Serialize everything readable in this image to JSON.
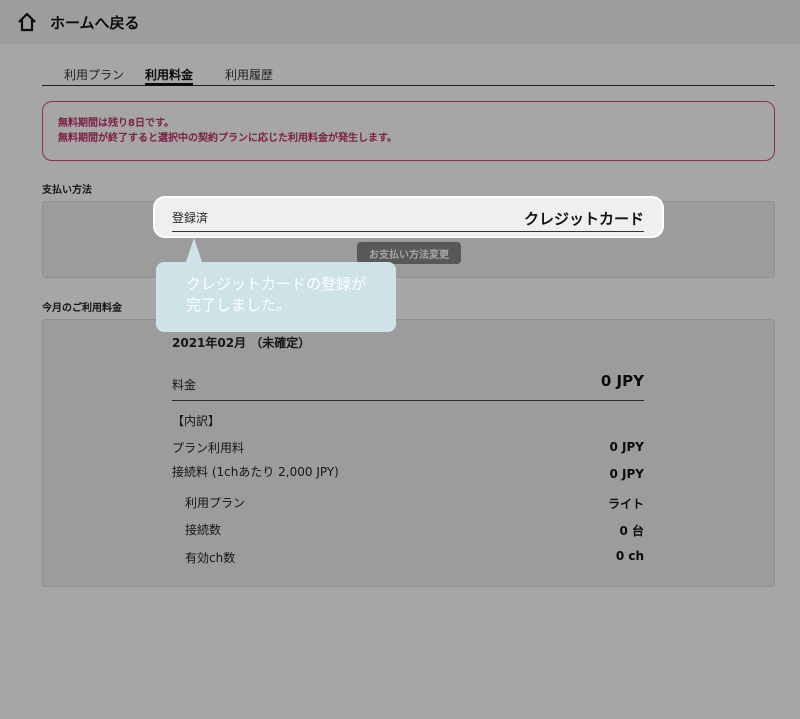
{
  "header": {
    "title": "ホームへ戻る"
  },
  "tabs": [
    {
      "label": "利用プラン",
      "active": false
    },
    {
      "label": "利用料金",
      "active": true
    },
    {
      "label": "利用履歴",
      "active": false
    }
  ],
  "notice": {
    "line1": "無料期間は残り8日です。",
    "line2": "無料期間が終了すると選択中の契約プランに応じた利用料金が発生します。"
  },
  "payment": {
    "section_label": "支払い方法",
    "status_label": "登録済",
    "method": "クレジットカード",
    "change_button": "お支払い方法変更"
  },
  "callout": {
    "text_line1": "クレジットカードの登録が",
    "text_line2": "完了しました。"
  },
  "billing": {
    "section_label": "今月のご利用料金",
    "period": "2021年02月 （未確定）",
    "fee_label": "料金",
    "fee_value": "0 JPY",
    "breakdown_label": "【内訳】",
    "plan_fee_label": "プラン利用料",
    "plan_fee_value": "0 JPY",
    "connection_fee_label": "接続料 (1chあたり 2,000 JPY)",
    "connection_fee_value": "0 JPY",
    "plan_label": "利用プラン",
    "plan_value": "ライト",
    "connections_label": "接続数",
    "connections_value": "0 台",
    "channels_label": "有効ch数",
    "channels_value": "0 ch"
  },
  "colors": {
    "accent_pink": "#d04a7a",
    "callout_bg": "#cde3e8"
  }
}
